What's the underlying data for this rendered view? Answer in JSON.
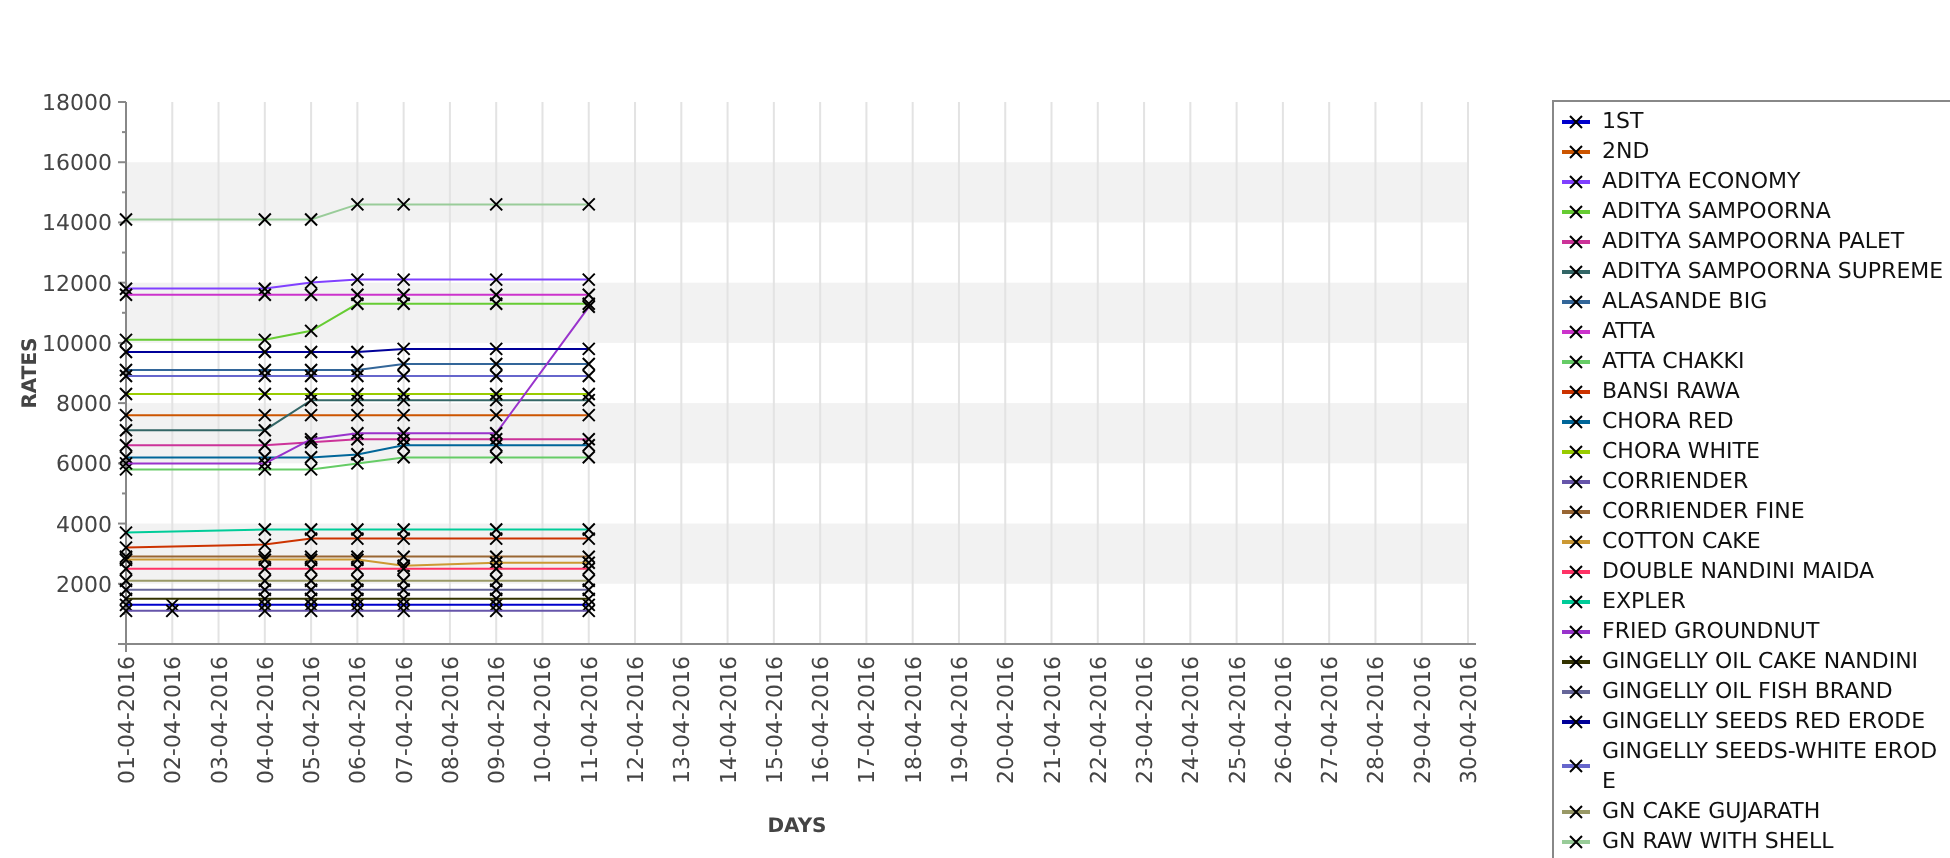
{
  "chart": {
    "chart_data": {
      "type": "line",
      "xlabel": "DAYS",
      "ylabel": "RATES",
      "categories": [
        "01-04-2016",
        "02-04-2016",
        "03-04-2016",
        "04-04-2016",
        "05-04-2016",
        "06-04-2016",
        "07-04-2016",
        "08-04-2016",
        "09-04-2016",
        "10-04-2016",
        "11-04-2016",
        "12-04-2016",
        "13-04-2016",
        "14-04-2016",
        "15-04-2016",
        "16-04-2016",
        "17-04-2016",
        "18-04-2016",
        "19-04-2016",
        "20-04-2016",
        "21-04-2016",
        "22-04-2016",
        "23-04-2016",
        "24-04-2016",
        "25-04-2016",
        "26-04-2016",
        "27-04-2016",
        "28-04-2016",
        "29-04-2016",
        "30-04-2016"
      ],
      "grid": true,
      "ylim": [
        0,
        18000
      ],
      "yticks": [
        2000,
        4000,
        6000,
        8000,
        10000,
        12000,
        14000,
        16000,
        18000
      ],
      "series": [
        {
          "name": "1ST",
          "color": "#0000cc",
          "marker": "x",
          "values": [
            1300,
            1300,
            null,
            1300,
            1300,
            1300,
            1300,
            null,
            1300,
            null,
            1300,
            null,
            null,
            null,
            null,
            null,
            null,
            null,
            null,
            null,
            null,
            null,
            null,
            null,
            null,
            null,
            null,
            null,
            null,
            null
          ]
        },
        {
          "name": "2ND",
          "color": "#cc5500",
          "marker": "x",
          "values": [
            7600,
            null,
            null,
            7600,
            7600,
            7600,
            7600,
            null,
            7600,
            null,
            7600,
            null,
            null,
            null,
            null,
            null,
            null,
            null,
            null,
            null,
            null,
            null,
            null,
            null,
            null,
            null,
            null,
            null,
            null,
            null
          ]
        },
        {
          "name": "ADITYA ECONOMY",
          "color": "#8040ff",
          "marker": "x",
          "values": [
            11800,
            null,
            null,
            11800,
            12000,
            12100,
            12100,
            null,
            12100,
            null,
            12100,
            null,
            null,
            null,
            null,
            null,
            null,
            null,
            null,
            null,
            null,
            null,
            null,
            null,
            null,
            null,
            null,
            null,
            null,
            null
          ]
        },
        {
          "name": "ADITYA SAMPOORNA",
          "color": "#66cc33",
          "marker": "x",
          "values": [
            10100,
            null,
            null,
            10100,
            10400,
            11300,
            11300,
            null,
            11300,
            null,
            11300,
            null,
            null,
            null,
            null,
            null,
            null,
            null,
            null,
            null,
            null,
            null,
            null,
            null,
            null,
            null,
            null,
            null,
            null,
            null
          ]
        },
        {
          "name": "ADITYA SAMPOORNA PALET",
          "color": "#cc3399",
          "marker": "x",
          "values": [
            6600,
            null,
            null,
            6600,
            6700,
            6800,
            6800,
            null,
            6800,
            null,
            6800,
            null,
            null,
            null,
            null,
            null,
            null,
            null,
            null,
            null,
            null,
            null,
            null,
            null,
            null,
            null,
            null,
            null,
            null,
            null
          ]
        },
        {
          "name": "ADITYA SAMPOORNA SUPREME",
          "color": "#336666",
          "marker": "x",
          "values": [
            7100,
            null,
            null,
            7100,
            8100,
            8100,
            8100,
            null,
            8100,
            null,
            8100,
            null,
            null,
            null,
            null,
            null,
            null,
            null,
            null,
            null,
            null,
            null,
            null,
            null,
            null,
            null,
            null,
            null,
            null,
            null
          ]
        },
        {
          "name": "ALASANDE BIG",
          "color": "#336699",
          "marker": "x",
          "values": [
            9100,
            null,
            null,
            9100,
            9100,
            9100,
            9300,
            null,
            9300,
            null,
            9300,
            null,
            null,
            null,
            null,
            null,
            null,
            null,
            null,
            null,
            null,
            null,
            null,
            null,
            null,
            null,
            null,
            null,
            null,
            null
          ]
        },
        {
          "name": "ATTA",
          "color": "#cc33cc",
          "marker": "x",
          "values": [
            11600,
            null,
            null,
            11600,
            11600,
            11600,
            11600,
            null,
            11600,
            null,
            11600,
            null,
            null,
            null,
            null,
            null,
            null,
            null,
            null,
            null,
            null,
            null,
            null,
            null,
            null,
            null,
            null,
            null,
            null,
            null
          ]
        },
        {
          "name": "ATTA CHAKKI",
          "color": "#66cc66",
          "marker": "x",
          "values": [
            5800,
            null,
            null,
            5800,
            5800,
            6000,
            6200,
            null,
            6200,
            null,
            6200,
            null,
            null,
            null,
            null,
            null,
            null,
            null,
            null,
            null,
            null,
            null,
            null,
            null,
            null,
            null,
            null,
            null,
            null,
            null
          ]
        },
        {
          "name": "BANSI RAWA",
          "color": "#cc3300",
          "marker": "x",
          "values": [
            3200,
            null,
            null,
            3300,
            3500,
            3500,
            3500,
            null,
            3500,
            null,
            3500,
            null,
            null,
            null,
            null,
            null,
            null,
            null,
            null,
            null,
            null,
            null,
            null,
            null,
            null,
            null,
            null,
            null,
            null,
            null
          ]
        },
        {
          "name": "CHORA RED",
          "color": "#006699",
          "marker": "x",
          "values": [
            6200,
            null,
            null,
            6200,
            6200,
            6300,
            6600,
            null,
            6600,
            null,
            6600,
            null,
            null,
            null,
            null,
            null,
            null,
            null,
            null,
            null,
            null,
            null,
            null,
            null,
            null,
            null,
            null,
            null,
            null,
            null
          ]
        },
        {
          "name": "CHORA WHITE",
          "color": "#99cc00",
          "marker": "x",
          "values": [
            8300,
            null,
            null,
            8300,
            8300,
            8300,
            8300,
            null,
            8300,
            null,
            8300,
            null,
            null,
            null,
            null,
            null,
            null,
            null,
            null,
            null,
            null,
            null,
            null,
            null,
            null,
            null,
            null,
            null,
            null,
            null
          ]
        },
        {
          "name": "CORRIENDER",
          "color": "#6655aa",
          "marker": "x",
          "values": [
            1100,
            1100,
            null,
            1100,
            1100,
            1100,
            1100,
            null,
            1100,
            null,
            1100,
            null,
            null,
            null,
            null,
            null,
            null,
            null,
            null,
            null,
            null,
            null,
            null,
            null,
            null,
            null,
            null,
            null,
            null,
            null
          ]
        },
        {
          "name": "CORRIENDER FINE",
          "color": "#996633",
          "marker": "x",
          "values": [
            2900,
            null,
            null,
            2900,
            2900,
            2900,
            2900,
            null,
            2900,
            null,
            2900,
            null,
            null,
            null,
            null,
            null,
            null,
            null,
            null,
            null,
            null,
            null,
            null,
            null,
            null,
            null,
            null,
            null,
            null,
            null
          ]
        },
        {
          "name": "COTTON CAKE",
          "color": "#cc9933",
          "marker": "x",
          "values": [
            2800,
            null,
            null,
            2800,
            2800,
            2800,
            2600,
            null,
            2700,
            null,
            2700,
            null,
            null,
            null,
            null,
            null,
            null,
            null,
            null,
            null,
            null,
            null,
            null,
            null,
            null,
            null,
            null,
            null,
            null,
            null
          ]
        },
        {
          "name": "DOUBLE NANDINI MAIDA",
          "color": "#ff3366",
          "marker": "x",
          "values": [
            2500,
            null,
            null,
            2500,
            2500,
            2500,
            2500,
            null,
            2500,
            null,
            2500,
            null,
            null,
            null,
            null,
            null,
            null,
            null,
            null,
            null,
            null,
            null,
            null,
            null,
            null,
            null,
            null,
            null,
            null,
            null
          ]
        },
        {
          "name": "EXPLER",
          "color": "#00cc99",
          "marker": "x",
          "values": [
            3700,
            null,
            null,
            3800,
            3800,
            3800,
            3800,
            null,
            3800,
            null,
            3800,
            null,
            null,
            null,
            null,
            null,
            null,
            null,
            null,
            null,
            null,
            null,
            null,
            null,
            null,
            null,
            null,
            null,
            null,
            null
          ]
        },
        {
          "name": "FRIED GROUNDNUT",
          "color": "#9933cc",
          "marker": "x",
          "values": [
            6000,
            null,
            null,
            6000,
            6800,
            7000,
            7000,
            null,
            7000,
            null,
            11200,
            null,
            null,
            null,
            null,
            null,
            null,
            null,
            null,
            null,
            null,
            null,
            null,
            null,
            null,
            null,
            null,
            null,
            null,
            null
          ]
        },
        {
          "name": "GINGELLY OIL CAKE NANDINI",
          "color": "#333300",
          "marker": "x",
          "values": [
            1500,
            null,
            null,
            1500,
            1500,
            1500,
            1500,
            null,
            1500,
            null,
            1500,
            null,
            null,
            null,
            null,
            null,
            null,
            null,
            null,
            null,
            null,
            null,
            null,
            null,
            null,
            null,
            null,
            null,
            null,
            null
          ]
        },
        {
          "name": "GINGELLY OIL FISH BRAND",
          "color": "#666699",
          "marker": "x",
          "values": [
            1800,
            null,
            null,
            1800,
            1800,
            1800,
            1800,
            null,
            1800,
            null,
            1800,
            null,
            null,
            null,
            null,
            null,
            null,
            null,
            null,
            null,
            null,
            null,
            null,
            null,
            null,
            null,
            null,
            null,
            null,
            null
          ]
        },
        {
          "name": "GINGELLY SEEDS RED ERODE",
          "color": "#000099",
          "marker": "x",
          "values": [
            9700,
            null,
            null,
            9700,
            9700,
            9700,
            9800,
            null,
            9800,
            null,
            9800,
            null,
            null,
            null,
            null,
            null,
            null,
            null,
            null,
            null,
            null,
            null,
            null,
            null,
            null,
            null,
            null,
            null,
            null,
            null
          ]
        },
        {
          "name": "GINGELLY SEEDS-WHITE ERODE",
          "color": "#6666cc",
          "marker": "x",
          "values": [
            8900,
            null,
            null,
            8900,
            8900,
            8900,
            8900,
            null,
            8900,
            null,
            8900,
            null,
            null,
            null,
            null,
            null,
            null,
            null,
            null,
            null,
            null,
            null,
            null,
            null,
            null,
            null,
            null,
            null,
            null,
            null
          ]
        },
        {
          "name": "GN CAKE GUJARATH",
          "color": "#999966",
          "marker": "x",
          "values": [
            2100,
            null,
            null,
            2100,
            2100,
            2100,
            2100,
            null,
            2100,
            null,
            2100,
            null,
            null,
            null,
            null,
            null,
            null,
            null,
            null,
            null,
            null,
            null,
            null,
            null,
            null,
            null,
            null,
            null,
            null,
            null
          ]
        },
        {
          "name": "GN RAW WITH SHELL",
          "color": "#99cc99",
          "marker": "x",
          "values": [
            14100,
            null,
            null,
            14100,
            14100,
            14600,
            14600,
            null,
            14600,
            null,
            14600,
            null,
            null,
            null,
            null,
            null,
            null,
            null,
            null,
            null,
            null,
            null,
            null,
            null,
            null,
            null,
            null,
            null,
            null,
            null
          ]
        }
      ]
    }
  }
}
